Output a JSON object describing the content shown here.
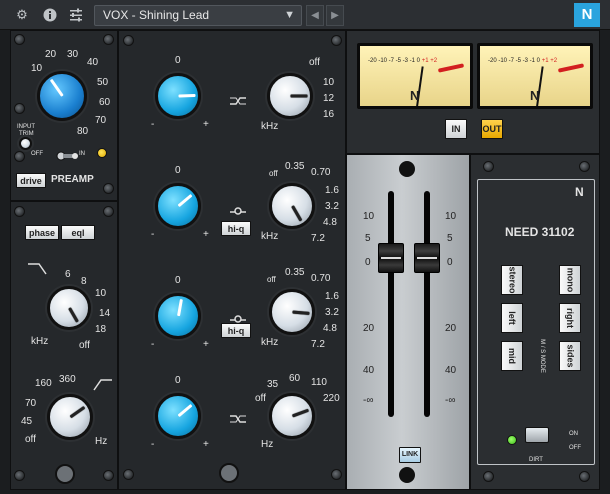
{
  "toolbar": {
    "preset_name": "VOX - Shining Lead",
    "icons": [
      "gear-icon",
      "info-icon",
      "sliders-icon",
      "chevron-down-icon",
      "prev-icon",
      "next-icon",
      "neve-logo-icon"
    ],
    "logo_letter": "N",
    "accent": "#2aa4de"
  },
  "preamp": {
    "scale": [
      "10",
      "20",
      "30",
      "40",
      "50",
      "60",
      "70",
      "80"
    ],
    "input_trim_label_1": "INPUT",
    "input_trim_label_2": "TRIM",
    "off_label": "OFF",
    "in_label": "IN",
    "drive_label": "drive",
    "title": "PREAMP"
  },
  "filters": {
    "phase_label": "phase",
    "eql_label": "eql",
    "hp": {
      "scale": [
        "6",
        "8",
        "10",
        "14",
        "18"
      ],
      "unit": "kHz",
      "off": "off"
    },
    "lp": {
      "scale": [
        "160",
        "360",
        "70",
        "45"
      ],
      "off": "off",
      "unit": "Hz"
    }
  },
  "eq": {
    "band1": {
      "gain_zero": "0",
      "minus": "-",
      "plus": "+",
      "freq_scale": [
        "off",
        "10",
        "12",
        "16"
      ],
      "unit": "kHz"
    },
    "band2": {
      "gain_zero": "0",
      "minus": "-",
      "plus": "+",
      "hiq": "hi-q",
      "freq_scale": [
        "off",
        "0.35",
        "0.70",
        "1.6",
        "3.2",
        "4.8",
        "7.2"
      ],
      "unit": "kHz"
    },
    "band3": {
      "gain_zero": "0",
      "minus": "-",
      "plus": "+",
      "hiq": "hi-q",
      "freq_scale": [
        "off",
        "0.35",
        "0.70",
        "1.6",
        "3.2",
        "4.8",
        "7.2"
      ],
      "unit": "kHz"
    },
    "band4": {
      "gain_zero": "0",
      "minus": "-",
      "plus": "+",
      "freq_scale": [
        "35",
        "60",
        "110",
        "220",
        "off"
      ],
      "unit": "Hz"
    }
  },
  "meters": {
    "scale_left": "-20 -10 -7 -5 -3 -1 0",
    "scale_right": "+1 +2",
    "logo": "N",
    "in_label": "IN",
    "out_label": "OUT"
  },
  "fader": {
    "scale_left": [
      "10",
      "5",
      "0",
      "20",
      "40",
      "-∞"
    ],
    "scale_right": [
      "10",
      "5",
      "0",
      "20",
      "40",
      "-∞"
    ],
    "link_label": "LINK"
  },
  "need": {
    "title": "NEED 31102",
    "logo": "N",
    "stereo": "stereo",
    "left": "left",
    "mid": "mid",
    "mono": "mono",
    "right": "right",
    "sides": "sides",
    "mode_label": "M / S MODE",
    "on_label": "ON",
    "off_label": "OFF",
    "dirt_label": "DIRT"
  }
}
